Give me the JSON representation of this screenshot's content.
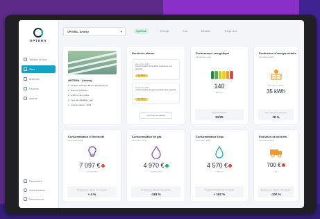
{
  "app": {
    "brand": "OPTERA"
  },
  "sidebar": {
    "items": [
      {
        "label": "Tableau de bord",
        "icon": "dashboard-icon",
        "active": false
      },
      {
        "label": "Sites",
        "icon": "building-icon",
        "active": true
      },
      {
        "label": "Analyses",
        "icon": "chart-icon",
        "active": false
      },
      {
        "label": "Factures",
        "icon": "invoice-icon",
        "active": false
      },
      {
        "label": "Alertes",
        "icon": "bell-icon",
        "active": false
      }
    ],
    "bottom": [
      {
        "label": "Paramètres",
        "icon": "gear-icon"
      },
      {
        "label": "Administrateur",
        "icon": "user-icon"
      },
      {
        "label": "Déconnexion",
        "icon": "logout-icon"
      }
    ]
  },
  "topbar": {
    "org_select": "OPTERA - Annecy",
    "tabs": [
      "Synthèse",
      "Énergie",
      "Eau",
      "Déchets",
      "Temps réel"
    ]
  },
  "site": {
    "name": "OPTERA · Annecy",
    "lines": [
      "12 allée Théodore Monod 74000 Annecy",
      "Bureaux / Tertiaire",
      "2 500 m² de surface",
      "Type de chauffage : gaz",
      "Consommation : 2023"
    ]
  },
  "alerts": {
    "title": "Dernières alertes",
    "items": [
      {
        "date": "Décembre 2023",
        "text": "Consommation d'électricité supérieure aux objectifs",
        "badge": "En cours"
      },
      {
        "date": "Novembre 2023",
        "text": "Consommation de gaz supérieure aux objectifs",
        "badge": "En cours"
      }
    ],
    "button": "Voir toutes les alertes"
  },
  "energy_perf": {
    "title": "Performance énergétique",
    "sub": "12 derniers mois",
    "value": "140",
    "unit": "kWh/m²",
    "footer_label": "Écart à l'objectif",
    "footer_value": "91/25",
    "gauge_colors": [
      "#1d8a3d",
      "#4fb346",
      "#b6d23a",
      "#f2d02c",
      "#f29a2c",
      "#e5483b"
    ]
  },
  "solar": {
    "title": "Production d'énergie solaire",
    "sub": "Décembre 2023",
    "caption": "Énergie produite",
    "value": "35 kWh",
    "footer_label": "Taux d'autoconsommation",
    "footer_value": "18 %"
  },
  "electricity": {
    "title": "Consommation d'électricité",
    "sub": "Décembre 2023",
    "value": "7 097 €",
    "caption": "25 000 kWh",
    "footer_label": "Évolution par rapport à l'an dernier",
    "footer_value": "+ 4 %"
  },
  "gas": {
    "title": "Consommation de gaz",
    "sub": "Décembre 2023",
    "value": "4 970 €",
    "caption": "45 000 kWh",
    "footer_label": "Évolution par rapport à l'an dernier",
    "footer_value": "-183 %"
  },
  "water": {
    "title": "Consommation d'eau",
    "sub": "Décembre 2023",
    "value": "4 570 €",
    "caption": "1 500 m³",
    "footer_label": "Évolution par rapport à l'an dernier",
    "footer_value": "+ 182 %"
  },
  "waste": {
    "title": "Évolution de déchets",
    "sub": "Décembre 2023",
    "value": "700 €",
    "caption": "150 t",
    "footer_label": "Évolution par rapport à l'an dernier",
    "footer_value": "-100 %"
  },
  "colors": {
    "accent": "#14a2c4",
    "up": "#e5483b",
    "down": "#21b36b",
    "orange": "#f29a2c"
  }
}
